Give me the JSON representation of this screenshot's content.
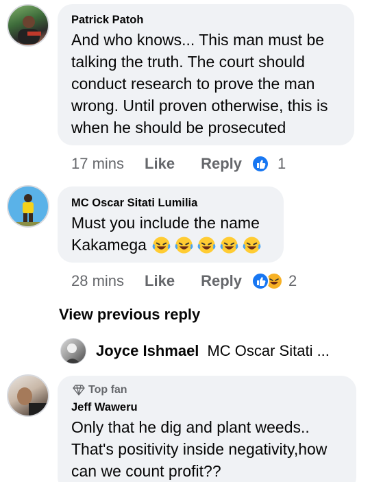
{
  "comments": [
    {
      "author": "Patrick Patoh",
      "text_lines": [
        "And who knows... This man must be",
        "talking the truth. The court should",
        "conduct research to prove the man",
        "wrong. Until proven otherwise, this is",
        "when he should be prosecuted"
      ],
      "time": "17 mins",
      "like_label": "Like",
      "reply_label": "Reply",
      "reaction_count": "1",
      "reactions": [
        "like-icon"
      ]
    },
    {
      "author": "MC Oscar Sitati Lumilia",
      "text_lines": [
        "Must you include the name",
        "Kakamega"
      ],
      "emoji_count": 5,
      "time": "28 mins",
      "like_label": "Like",
      "reply_label": "Reply",
      "reaction_count": "2",
      "reactions": [
        "like-icon",
        "haha-icon"
      ]
    },
    {
      "badge": "Top fan",
      "author": "Jeff Waweru",
      "text_lines": [
        "Only that he dig and plant weeds..",
        "That's positivity inside negativity,how",
        "can we count profit??"
      ]
    }
  ],
  "view_previous_reply": "View previous reply",
  "reply_preview": {
    "name": "Joyce Ishmael",
    "text": "MC Oscar Sitati ..."
  },
  "colors": {
    "bubble": "#f0f2f5",
    "meta": "#65676b",
    "like_blue": "#1877f2",
    "haha_yellow": "#f7b125"
  }
}
